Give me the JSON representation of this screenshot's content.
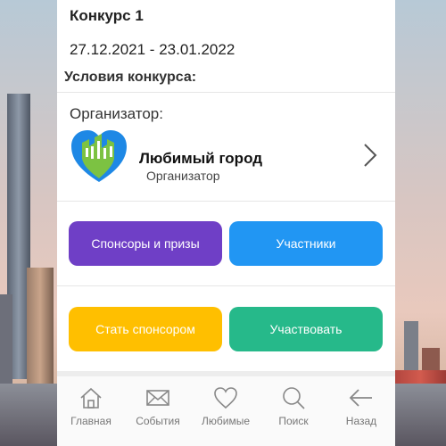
{
  "contest": {
    "title": "Конкурс 1",
    "dates": "27.12.2021 - 23.01.2022",
    "conditions_label": "Условия конкурса:"
  },
  "organizer": {
    "section_label": "Организатор:",
    "name": "Любимый город",
    "role": "Организатор",
    "logo_colors": [
      "#1e88e5",
      "#7cc242"
    ]
  },
  "actions": {
    "sponsors_prizes": "Спонсоры и призы",
    "participants": "Участники",
    "become_sponsor": "Стать спонсором",
    "participate": "Участвовать"
  },
  "colors": {
    "sponsors_prizes": "#6f3fc6",
    "participants": "#2196f3",
    "become_sponsor": "#ffbf00",
    "participate": "#26b98a"
  },
  "tabbar": {
    "items": [
      {
        "label": "Главная",
        "icon": "home-icon"
      },
      {
        "label": "События",
        "icon": "envelope-icon"
      },
      {
        "label": "Любимые",
        "icon": "heart-icon"
      },
      {
        "label": "Поиск",
        "icon": "search-icon"
      },
      {
        "label": "Назад",
        "icon": "back-arrow-icon"
      }
    ]
  }
}
